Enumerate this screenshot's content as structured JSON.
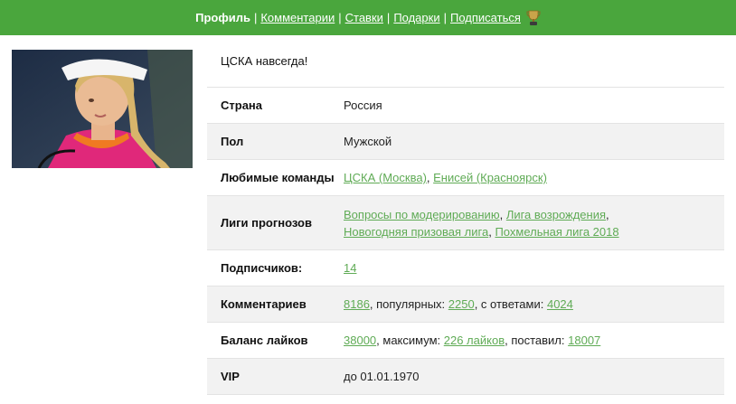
{
  "nav": {
    "current": "Профиль",
    "links": [
      "Комментарии",
      "Ставки",
      "Подарки",
      "Подписаться"
    ],
    "separator": "|",
    "trophy_icon": "trophy-icon"
  },
  "profile": {
    "status": "ЦСКА навсегда!"
  },
  "info": {
    "country": {
      "label": "Страна",
      "value": "Россия"
    },
    "gender": {
      "label": "Пол",
      "value": "Мужской"
    },
    "teams": {
      "label": "Любимые команды",
      "links": [
        "ЦСКА (Москва)",
        "Енисей (Красноярск)"
      ],
      "sep": ", "
    },
    "leagues": {
      "label": "Лиги прогнозов",
      "links": [
        "Вопросы по модерированию",
        "Лига возрождения",
        "Новогодняя призовая лига",
        "Похмельная лига 2018"
      ],
      "sep": ", "
    },
    "subscribers": {
      "label": "Подписчиков:",
      "value": "14"
    },
    "comments": {
      "label": "Комментариев",
      "total": "8186",
      "popular_text": ", популярных: ",
      "popular": "2250",
      "replies_text": ", с ответами: ",
      "replies": "4024"
    },
    "likes": {
      "label": "Баланс лайков",
      "balance": "38000",
      "max_text": ", максимум: ",
      "max": "226 лайков",
      "given_text": ", поставил: ",
      "given": "18007"
    },
    "vip": {
      "label": "VIP",
      "value": "до 01.01.1970"
    }
  },
  "colors": {
    "nav_bg": "#4aa63d",
    "link": "#5fab55",
    "row_alt": "#f2f2f2"
  }
}
